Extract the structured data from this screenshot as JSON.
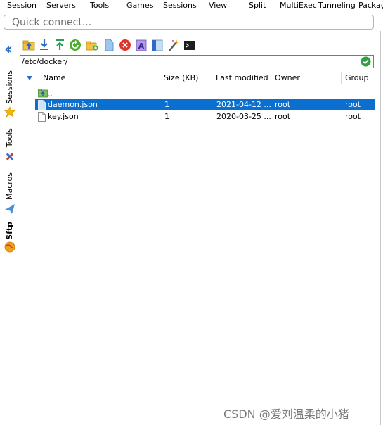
{
  "menu": [
    "Session",
    "Servers",
    "Tools",
    "Games",
    "Sessions",
    "View",
    "Split",
    "MultiExec",
    "Tunneling",
    "Packag"
  ],
  "quick_connect": {
    "placeholder": "Quick connect..."
  },
  "side_tabs": [
    "Sessions",
    "Tools",
    "Macros",
    "Sftp"
  ],
  "toolbar_icons": [
    "parent-folder-icon",
    "download-icon",
    "upload-icon",
    "refresh-icon",
    "new-folder-icon",
    "new-file-icon",
    "delete-icon",
    "rename-icon",
    "properties-icon",
    "magic-wand-icon",
    "terminal-icon"
  ],
  "path": "/etc/docker/",
  "columns": [
    "Name",
    "Size (KB)",
    "Last modified",
    "Owner",
    "Group"
  ],
  "rows": [
    {
      "name": "..",
      "size": "",
      "modified": "",
      "owner": "",
      "group": "",
      "kind": "parent"
    },
    {
      "name": "daemon.json",
      "size": "1",
      "modified": "2021-04-12 ...",
      "owner": "root",
      "group": "root",
      "kind": "file",
      "selected": true
    },
    {
      "name": "key.json",
      "size": "1",
      "modified": "2020-03-25 ...",
      "owner": "root",
      "group": "root",
      "kind": "file",
      "selected": false
    }
  ],
  "watermark": "CSDN @爱刘温柔的小猪",
  "colors": {
    "selection": "#0b6fcf",
    "accent": "#2e6fc4",
    "ok": "#2ea043"
  }
}
